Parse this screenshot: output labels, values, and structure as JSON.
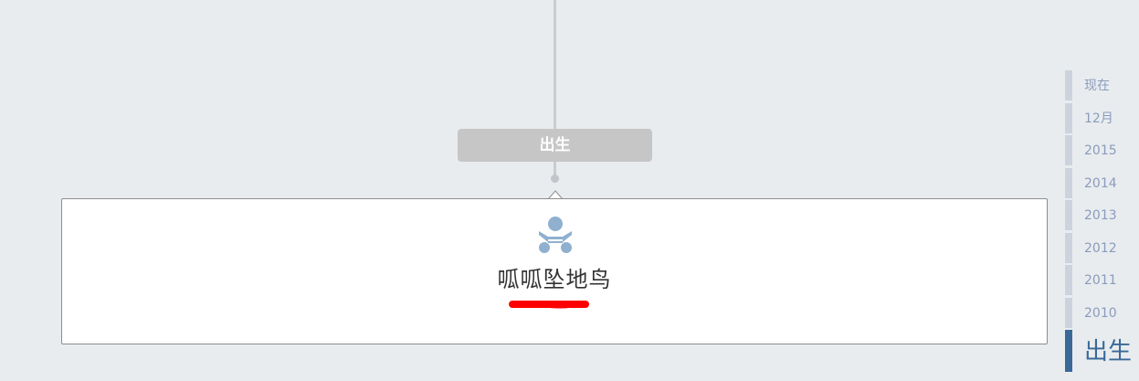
{
  "timeline": {
    "section_label": "出生"
  },
  "event_card": {
    "icon": "baby-icon",
    "title": "呱呱坠地鸟"
  },
  "year_nav": {
    "items": [
      "现在",
      "12月",
      "2015",
      "2014",
      "2013",
      "2012",
      "2011",
      "2010",
      "出生"
    ],
    "active": "出生"
  },
  "colors": {
    "background": "#e9ecef",
    "label_bg": "#c6c6c6",
    "nav_inactive_bar": "#ccd3dd",
    "nav_active": "#3a6998",
    "icon": "#8fb0cf",
    "redaction": "#ff0000"
  }
}
